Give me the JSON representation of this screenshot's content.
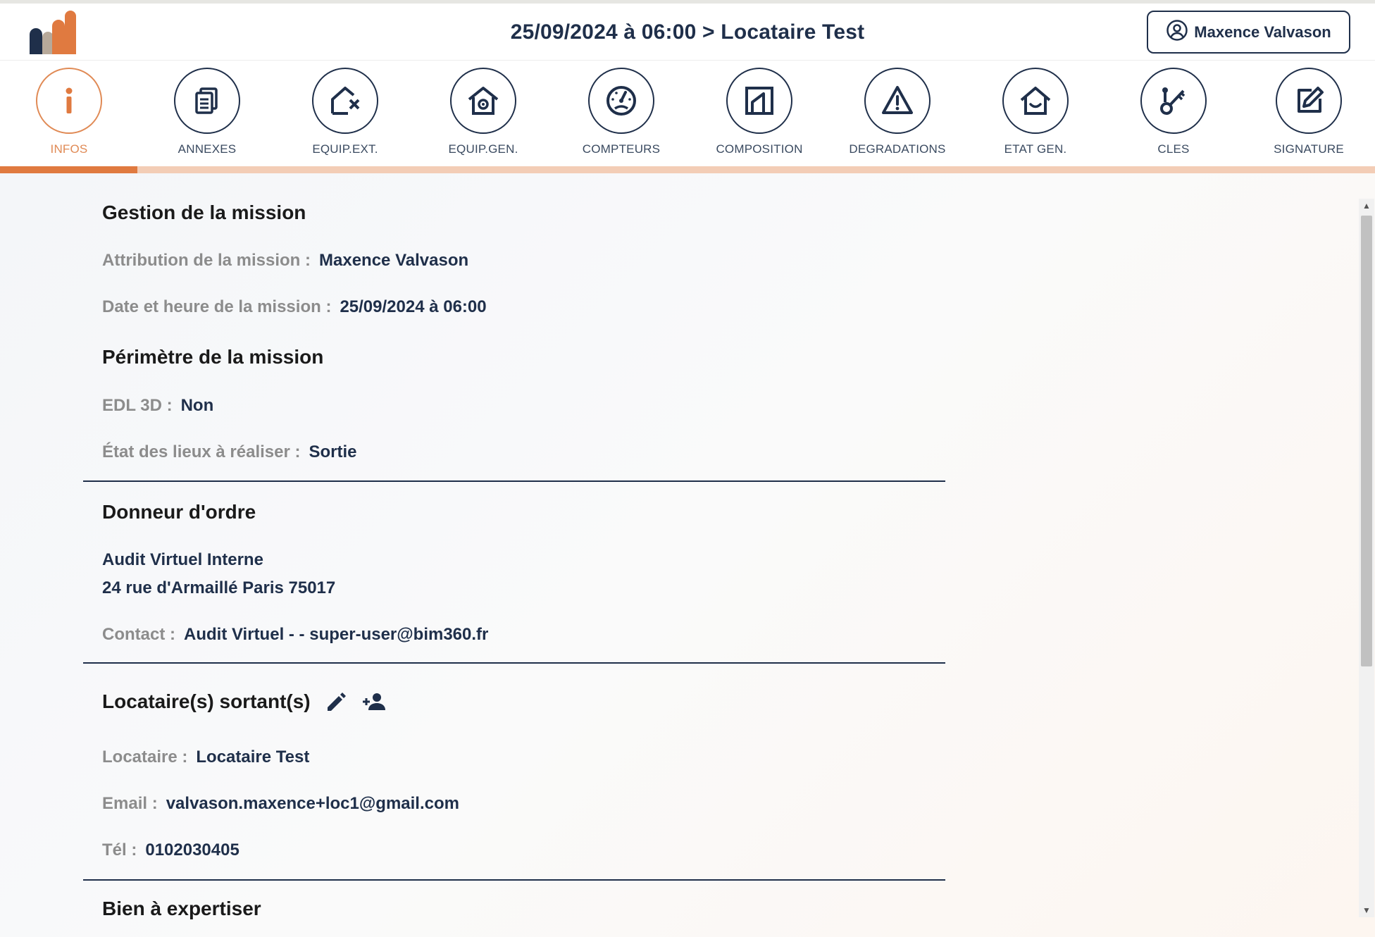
{
  "header": {
    "title": "25/09/2024 à 06:00 > Locataire Test",
    "user_name": "Maxence Valvason"
  },
  "nav": {
    "items": [
      {
        "label": "INFOS",
        "icon": "info-icon",
        "active": true
      },
      {
        "label": "ANNEXES",
        "icon": "documents-icon"
      },
      {
        "label": "EQUIP.EXT.",
        "icon": "house-x-icon"
      },
      {
        "label": "EQUIP.GEN.",
        "icon": "house-gear-icon"
      },
      {
        "label": "COMPTEURS",
        "icon": "gauge-icon"
      },
      {
        "label": "COMPOSITION",
        "icon": "floorplan-icon"
      },
      {
        "label": "DEGRADATIONS",
        "icon": "warning-icon"
      },
      {
        "label": "ETAT GEN.",
        "icon": "house-smile-icon"
      },
      {
        "label": "CLES",
        "icon": "keys-icon"
      },
      {
        "label": "SIGNATURE",
        "icon": "edit-icon"
      }
    ],
    "progress_fraction": 0.1
  },
  "mission": {
    "title": "Gestion de la mission",
    "assignment_label": "Attribution de la mission :",
    "assignment_value": "Maxence Valvason",
    "datetime_label": "Date et heure de la mission :",
    "datetime_value": "25/09/2024 à 06:00"
  },
  "scope": {
    "title": "Périmètre de la mission",
    "edl3d_label": "EDL 3D :",
    "edl3d_value": "Non",
    "type_label": "État des lieux à réaliser :",
    "type_value": "Sortie"
  },
  "client": {
    "title": "Donneur d'ordre",
    "name": "Audit Virtuel Interne",
    "address": "24 rue d'Armaillé Paris 75017",
    "contact_label": "Contact :",
    "contact_value": "Audit Virtuel - - super-user@bim360.fr"
  },
  "tenants": {
    "title": "Locataire(s) sortant(s)",
    "tenant_label": "Locataire :",
    "tenant_value": "Locataire Test",
    "email_label": "Email :",
    "email_value": "valvason.maxence+loc1@gmail.com",
    "phone_label": "Tél :",
    "phone_value": "0102030405"
  },
  "property": {
    "title": "Bien à expertiser"
  },
  "colors": {
    "navy": "#1f2f4a",
    "accent": "#e07a40",
    "accent_light": "#f3cdb6",
    "muted_label": "#8c8c8c"
  }
}
